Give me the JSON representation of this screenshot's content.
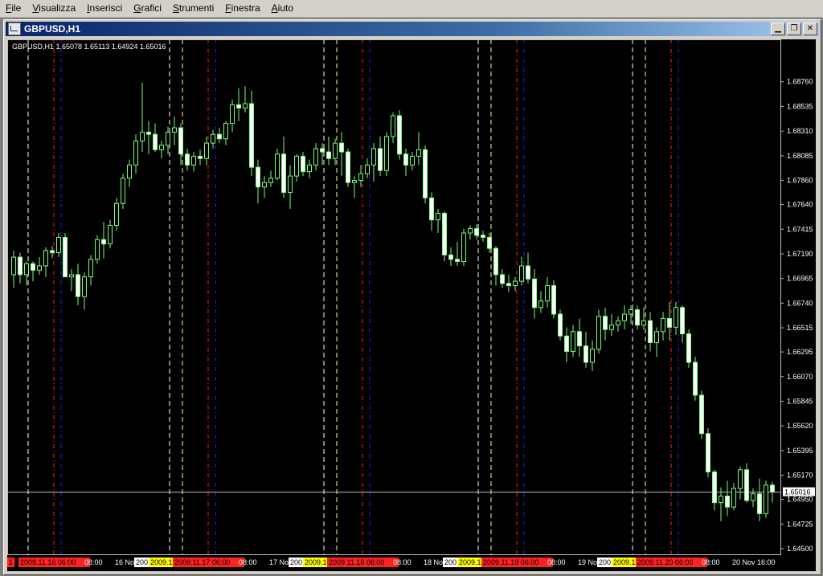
{
  "menubar": {
    "items": [
      "File",
      "Visualizza",
      "Inserisci",
      "Grafici",
      "Strumenti",
      "Finestra",
      "Aiuto"
    ]
  },
  "window": {
    "title": "GBPUSD,H1",
    "buttons": [
      "minimize",
      "restore",
      "close"
    ]
  },
  "colors": {
    "bg": "#000000",
    "candle": "#7cfc7c",
    "bull_body": "#000000",
    "bear_body": "#ffffff",
    "grid_white": "#ffffff",
    "grid_yellow": "#ffff99",
    "line_red": "#ff2020",
    "line_blue": "#2020ff",
    "bid_line": "#c0c0c0"
  },
  "chart_data": {
    "type": "candlestick",
    "symbol": "GBPUSD",
    "timeframe": "H1",
    "info_label": "GBPUSD,H1  1.65078 1.65113 1.64924 1.65016",
    "ylim": [
      1.645,
      1.69
    ],
    "y_ticks": [
      "1.68760",
      "1.68535",
      "1.68310",
      "1.68085",
      "1.67860",
      "1.67640",
      "1.67415",
      "1.67190",
      "1.66965",
      "1.66740",
      "1.66515",
      "1.66295",
      "1.66070",
      "1.65845",
      "1.65620",
      "1.65395",
      "1.65170",
      "1.64950",
      "1.64725",
      "1.64500"
    ],
    "current_price": "1.65016",
    "current_price_value": 1.65016,
    "candles": [
      [
        1.67,
        1.6722,
        1.6688,
        1.6716
      ],
      [
        1.6716,
        1.672,
        1.6692,
        1.67
      ],
      [
        1.67,
        1.6712,
        1.669,
        1.671
      ],
      [
        1.671,
        1.6712,
        1.6694,
        1.6704
      ],
      [
        1.6704,
        1.6716,
        1.67,
        1.6708
      ],
      [
        1.6708,
        1.6725,
        1.6698,
        1.6722
      ],
      [
        1.6722,
        1.6726,
        1.6715,
        1.672
      ],
      [
        1.672,
        1.6738,
        1.6716,
        1.6734
      ],
      [
        1.6734,
        1.6738,
        1.67,
        1.6698
      ],
      [
        1.6698,
        1.6705,
        1.6685,
        1.67
      ],
      [
        1.67,
        1.671,
        1.6672,
        1.668
      ],
      [
        1.668,
        1.6702,
        1.6668,
        1.6698
      ],
      [
        1.6698,
        1.6718,
        1.669,
        1.6714
      ],
      [
        1.6714,
        1.6736,
        1.671,
        1.6732
      ],
      [
        1.6732,
        1.6748,
        1.6715,
        1.6728
      ],
      [
        1.6728,
        1.675,
        1.6724,
        1.6745
      ],
      [
        1.6745,
        1.677,
        1.674,
        1.6765
      ],
      [
        1.6765,
        1.6792,
        1.676,
        1.6788
      ],
      [
        1.6788,
        1.6805,
        1.678,
        1.68
      ],
      [
        1.68,
        1.6828,
        1.6792,
        1.6822
      ],
      [
        1.6822,
        1.6875,
        1.6812,
        1.683
      ],
      [
        1.683,
        1.684,
        1.681,
        1.6828
      ],
      [
        1.6828,
        1.6838,
        1.6812,
        1.6814
      ],
      [
        1.6814,
        1.6822,
        1.6806,
        1.6818
      ],
      [
        1.6818,
        1.6835,
        1.681,
        1.683
      ],
      [
        1.683,
        1.6844,
        1.6818,
        1.6834
      ],
      [
        1.6834,
        1.6838,
        1.68,
        1.681
      ],
      [
        1.681,
        1.6815,
        1.6795,
        1.68
      ],
      [
        1.68,
        1.6812,
        1.6794,
        1.6808
      ],
      [
        1.6808,
        1.6814,
        1.68,
        1.6806
      ],
      [
        1.6806,
        1.6826,
        1.68,
        1.682
      ],
      [
        1.682,
        1.6832,
        1.6815,
        1.6828
      ],
      [
        1.6828,
        1.6834,
        1.682,
        1.6824
      ],
      [
        1.6824,
        1.684,
        1.6818,
        1.6838
      ],
      [
        1.6838,
        1.686,
        1.683,
        1.6855
      ],
      [
        1.6855,
        1.687,
        1.684,
        1.6852
      ],
      [
        1.6852,
        1.6872,
        1.6848,
        1.6856
      ],
      [
        1.6856,
        1.6868,
        1.679,
        1.6798
      ],
      [
        1.6798,
        1.6805,
        1.6765,
        1.678
      ],
      [
        1.678,
        1.679,
        1.677,
        1.6784
      ],
      [
        1.6784,
        1.6795,
        1.678,
        1.6788
      ],
      [
        1.6788,
        1.6815,
        1.6786,
        1.681
      ],
      [
        1.681,
        1.6826,
        1.677,
        1.6775
      ],
      [
        1.6775,
        1.68,
        1.676,
        1.679
      ],
      [
        1.679,
        1.681,
        1.6785,
        1.6808
      ],
      [
        1.6808,
        1.6812,
        1.679,
        1.6794
      ],
      [
        1.6794,
        1.6805,
        1.6788,
        1.68
      ],
      [
        1.68,
        1.682,
        1.6795,
        1.6815
      ],
      [
        1.6815,
        1.682,
        1.68,
        1.6812
      ],
      [
        1.6812,
        1.6826,
        1.68,
        1.6806
      ],
      [
        1.6806,
        1.6824,
        1.68,
        1.682
      ],
      [
        1.682,
        1.683,
        1.679,
        1.6812
      ],
      [
        1.6812,
        1.6815,
        1.678,
        1.6784
      ],
      [
        1.6784,
        1.679,
        1.677,
        1.6786
      ],
      [
        1.6786,
        1.68,
        1.678,
        1.6792
      ],
      [
        1.6792,
        1.6806,
        1.6788,
        1.68
      ],
      [
        1.68,
        1.682,
        1.6785,
        1.6815
      ],
      [
        1.6815,
        1.6826,
        1.679,
        1.6795
      ],
      [
        1.6795,
        1.683,
        1.679,
        1.6826
      ],
      [
        1.6826,
        1.6848,
        1.682,
        1.6845
      ],
      [
        1.6845,
        1.685,
        1.6805,
        1.681
      ],
      [
        1.681,
        1.6815,
        1.679,
        1.68
      ],
      [
        1.68,
        1.6812,
        1.6795,
        1.6808
      ],
      [
        1.6808,
        1.683,
        1.68,
        1.6814
      ],
      [
        1.6814,
        1.6818,
        1.6765,
        1.677
      ],
      [
        1.677,
        1.6775,
        1.674,
        1.675
      ],
      [
        1.675,
        1.676,
        1.6738,
        1.6756
      ],
      [
        1.6756,
        1.6758,
        1.6712,
        1.6718
      ],
      [
        1.6718,
        1.6725,
        1.6708,
        1.6714
      ],
      [
        1.6714,
        1.673,
        1.6708,
        1.6712
      ],
      [
        1.6712,
        1.6742,
        1.6708,
        1.6738
      ],
      [
        1.6738,
        1.6745,
        1.6732,
        1.6742
      ],
      [
        1.6742,
        1.6746,
        1.6732,
        1.6736
      ],
      [
        1.6736,
        1.674,
        1.673,
        1.6734
      ],
      [
        1.6734,
        1.6738,
        1.672,
        1.6724
      ],
      [
        1.6724,
        1.6726,
        1.669,
        1.67
      ],
      [
        1.67,
        1.6705,
        1.6688,
        1.6692
      ],
      [
        1.6692,
        1.67,
        1.6684,
        1.669
      ],
      [
        1.669,
        1.6698,
        1.6685,
        1.6694
      ],
      [
        1.6694,
        1.6716,
        1.669,
        1.6708
      ],
      [
        1.6708,
        1.672,
        1.6692,
        1.6696
      ],
      [
        1.6696,
        1.6705,
        1.666,
        1.667
      ],
      [
        1.667,
        1.6685,
        1.6665,
        1.6676
      ],
      [
        1.6676,
        1.6698,
        1.667,
        1.669
      ],
      [
        1.669,
        1.6695,
        1.666,
        1.6664
      ],
      [
        1.6664,
        1.6668,
        1.664,
        1.6644
      ],
      [
        1.6644,
        1.6652,
        1.662,
        1.663
      ],
      [
        1.663,
        1.6654,
        1.6625,
        1.6648
      ],
      [
        1.6648,
        1.666,
        1.6625,
        1.6635
      ],
      [
        1.6635,
        1.6648,
        1.6615,
        1.662
      ],
      [
        1.662,
        1.664,
        1.6612,
        1.6632
      ],
      [
        1.6632,
        1.6668,
        1.6628,
        1.6662
      ],
      [
        1.6662,
        1.667,
        1.664,
        1.665
      ],
      [
        1.665,
        1.6664,
        1.6644,
        1.6654
      ],
      [
        1.6654,
        1.6662,
        1.6648,
        1.6658
      ],
      [
        1.6658,
        1.6672,
        1.665,
        1.6664
      ],
      [
        1.6664,
        1.6672,
        1.6655,
        1.6668
      ],
      [
        1.6668,
        1.6672,
        1.665,
        1.6654
      ],
      [
        1.6654,
        1.667,
        1.665,
        1.6658
      ],
      [
        1.6658,
        1.6666,
        1.663,
        1.6638
      ],
      [
        1.6638,
        1.6652,
        1.6625,
        1.6648
      ],
      [
        1.6648,
        1.6666,
        1.664,
        1.666
      ],
      [
        1.666,
        1.6675,
        1.664,
        1.6652
      ],
      [
        1.6652,
        1.6675,
        1.6645,
        1.667
      ],
      [
        1.667,
        1.6672,
        1.6638,
        1.6646
      ],
      [
        1.6646,
        1.665,
        1.6615,
        1.662
      ],
      [
        1.662,
        1.6625,
        1.6585,
        1.659
      ],
      [
        1.659,
        1.6594,
        1.655,
        1.6555
      ],
      [
        1.6555,
        1.656,
        1.6515,
        1.652
      ],
      [
        1.652,
        1.6522,
        1.6485,
        1.6492
      ],
      [
        1.6492,
        1.6506,
        1.6475,
        1.6498
      ],
      [
        1.6498,
        1.6512,
        1.648,
        1.6488
      ],
      [
        1.6488,
        1.651,
        1.6485,
        1.6505
      ],
      [
        1.6505,
        1.6525,
        1.6495,
        1.6522
      ],
      [
        1.6522,
        1.6528,
        1.6492,
        1.6494
      ],
      [
        1.6494,
        1.6505,
        1.6488,
        1.65
      ],
      [
        1.65,
        1.6514,
        1.6475,
        1.6482
      ],
      [
        1.6482,
        1.6512,
        1.6478,
        1.6508
      ],
      [
        1.6508,
        1.6511,
        1.6492,
        1.6502
      ]
    ],
    "vertical_lines": [
      {
        "x": 26,
        "color": "white",
        "style": "dashed"
      },
      {
        "x": 58,
        "color": "red",
        "style": "dashdot"
      },
      {
        "x": 67,
        "color": "blue",
        "style": "dashdot"
      },
      {
        "x": 202,
        "color": "white",
        "style": "dashed"
      },
      {
        "x": 218,
        "color": "yellow",
        "style": "dashed"
      },
      {
        "x": 250,
        "color": "red",
        "style": "dashdot"
      },
      {
        "x": 259,
        "color": "blue",
        "style": "dashdot"
      },
      {
        "x": 394,
        "color": "white",
        "style": "dashed"
      },
      {
        "x": 410,
        "color": "yellow",
        "style": "dashed"
      },
      {
        "x": 442,
        "color": "red",
        "style": "dashdot"
      },
      {
        "x": 451,
        "color": "blue",
        "style": "dashdot"
      },
      {
        "x": 586,
        "color": "white",
        "style": "dashed"
      },
      {
        "x": 602,
        "color": "yellow",
        "style": "dashed"
      },
      {
        "x": 634,
        "color": "red",
        "style": "dashdot"
      },
      {
        "x": 643,
        "color": "blue",
        "style": "dashdot"
      },
      {
        "x": 778,
        "color": "white",
        "style": "dashed"
      },
      {
        "x": 794,
        "color": "yellow",
        "style": "dashed"
      },
      {
        "x": 826,
        "color": "red",
        "style": "dashdot"
      },
      {
        "x": 835,
        "color": "blue",
        "style": "dashdot"
      }
    ],
    "time_axis": [
      {
        "x": 0,
        "text": "1",
        "bg": "#ff2020",
        "fg": "#000"
      },
      {
        "x": 14,
        "text": "2009.11.16 06:00",
        "bg": "#ff2020",
        "fg": "#000"
      },
      {
        "x": 94,
        "text": "08:00",
        "bg": "#000",
        "fg": "#fff"
      },
      {
        "x": 132,
        "text": "16 Nov",
        "bg": "#000",
        "fg": "#fff"
      },
      {
        "x": 158,
        "text": "200",
        "bg": "#ffffff",
        "fg": "#000"
      },
      {
        "x": 176,
        "text": "2009.1",
        "bg": "#ffff00",
        "fg": "#000"
      },
      {
        "x": 206,
        "text": "2009.11.17 06:00",
        "bg": "#ff2020",
        "fg": "#000"
      },
      {
        "x": 286,
        "text": "08:00",
        "bg": "#000",
        "fg": "#fff"
      },
      {
        "x": 324,
        "text": "17 No",
        "bg": "#000",
        "fg": "#fff"
      },
      {
        "x": 350,
        "text": "200",
        "bg": "#ffffff",
        "fg": "#000"
      },
      {
        "x": 368,
        "text": "2009.1",
        "bg": "#ffff00",
        "fg": "#000"
      },
      {
        "x": 398,
        "text": "2009.11.18 06:00",
        "bg": "#ff2020",
        "fg": "#000"
      },
      {
        "x": 478,
        "text": "08:00",
        "bg": "#000",
        "fg": "#fff"
      },
      {
        "x": 516,
        "text": "18 Nov",
        "bg": "#000",
        "fg": "#fff"
      },
      {
        "x": 542,
        "text": "200",
        "bg": "#ffffff",
        "fg": "#000"
      },
      {
        "x": 560,
        "text": "2009.1",
        "bg": "#ffff00",
        "fg": "#000"
      },
      {
        "x": 590,
        "text": "2009.11.19 06:00",
        "bg": "#ff2020",
        "fg": "#000"
      },
      {
        "x": 670,
        "text": "08:00",
        "bg": "#000",
        "fg": "#fff"
      },
      {
        "x": 708,
        "text": "19 Nov",
        "bg": "#000",
        "fg": "#fff"
      },
      {
        "x": 734,
        "text": "200",
        "bg": "#ffffff",
        "fg": "#000"
      },
      {
        "x": 752,
        "text": "2009.1",
        "bg": "#ffff00",
        "fg": "#000"
      },
      {
        "x": 782,
        "text": "2009.11.20 06:00",
        "bg": "#ff2020",
        "fg": "#000"
      },
      {
        "x": 862,
        "text": "08:00",
        "bg": "#000",
        "fg": "#fff"
      },
      {
        "x": 900,
        "text": "20 Nov 16:00",
        "bg": "#000",
        "fg": "#fff"
      }
    ]
  }
}
